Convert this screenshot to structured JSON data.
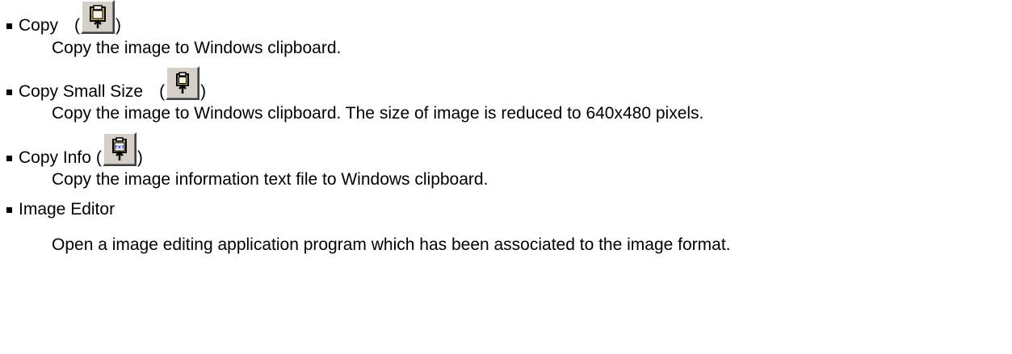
{
  "items": [
    {
      "title": "Copy",
      "icon": "clipboard-copy-icon",
      "description": "Copy the image to Windows clipboard."
    },
    {
      "title": "Copy Small Size",
      "icon": "clipboard-copy-small-icon",
      "description": "Copy the image to Windows clipboard. The size of image is reduced to 640x480 pixels."
    },
    {
      "title": "Copy Info",
      "icon": "clipboard-copy-info-icon",
      "icon_label": "TXT",
      "description": "Copy the image information text file to Windows clipboard."
    },
    {
      "title": "Image Editor",
      "description": "Open a image editing application program which has been associated to the image format."
    }
  ],
  "paren_open": "(",
  "paren_close": ")"
}
